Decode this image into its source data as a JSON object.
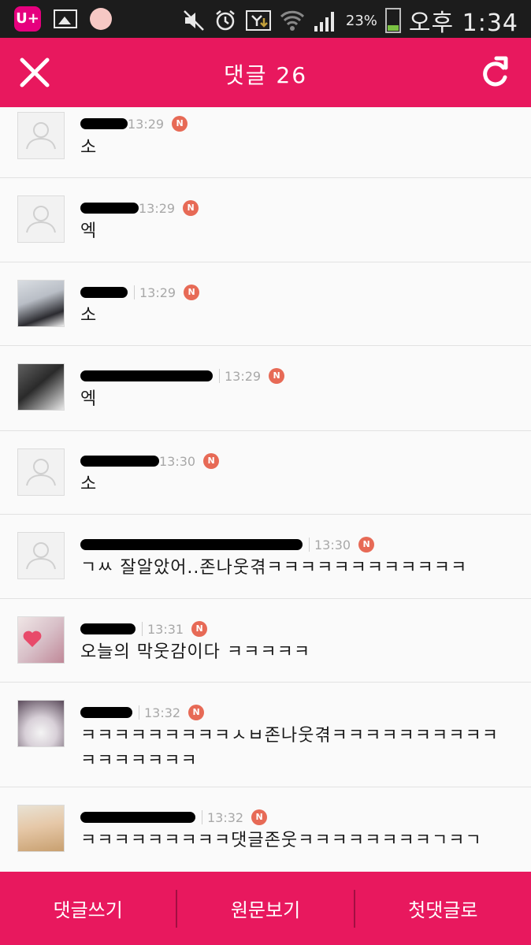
{
  "status_bar": {
    "carrier_icon": "U+",
    "battery_percent": "23%",
    "clock": "오후 1:34",
    "icons": [
      "lg-uplus-icon",
      "gallery-icon",
      "notification-dot-icon",
      "mute-icon",
      "alarm-icon",
      "sync-icon",
      "wifi-icon",
      "signal-icon",
      "battery-icon"
    ]
  },
  "header": {
    "title": "댓글 26",
    "close_icon": "close-icon",
    "refresh_icon": "refresh-icon",
    "color": "#e8185e"
  },
  "comments": [
    {
      "time": "13:29",
      "badge": "N",
      "text": "소",
      "avatar": "default"
    },
    {
      "time": "13:29",
      "badge": "N",
      "text": "엑",
      "avatar": "default"
    },
    {
      "time": "13:29",
      "badge": "N",
      "text": "소",
      "avatar": "photo"
    },
    {
      "time": "13:29",
      "badge": "N",
      "text": "엑",
      "avatar": "photo"
    },
    {
      "time": "13:30",
      "badge": "N",
      "text": "소",
      "avatar": "default"
    },
    {
      "time": "13:30",
      "badge": "N",
      "text": "ㄱㅆ 잘알았어..존나웃겪ㅋㅋㅋㅋㅋㅋㅋㅋㅋㅋㅋㅋ",
      "avatar": "default"
    },
    {
      "time": "13:31",
      "badge": "N",
      "text": "오늘의 막웃감이다 ㅋㅋㅋㅋㅋ",
      "avatar": "photo"
    },
    {
      "time": "13:32",
      "badge": "N",
      "text": "ㅋㅋㅋㅋㅋㅋㅋㅋㅋㅅㅂ존나웃겪ㅋㅋㅋㅋㅋㅋㅋㅋㅋㅋㅋㅋㅋㅋㅋㅋㅋ",
      "avatar": "photo"
    },
    {
      "time": "13:32",
      "badge": "N",
      "text": "ㅋㅋㅋㅋㅋㅋㅋㅋㅋ댓글존웃ㅋㅋㅋㅋㅋㅋㅋㅋㄱㅋㄱ",
      "avatar": "photo"
    }
  ],
  "bottom_bar": {
    "write_comment": "댓글쓰기",
    "view_original": "원문보기",
    "first_comment": "첫댓글로"
  }
}
